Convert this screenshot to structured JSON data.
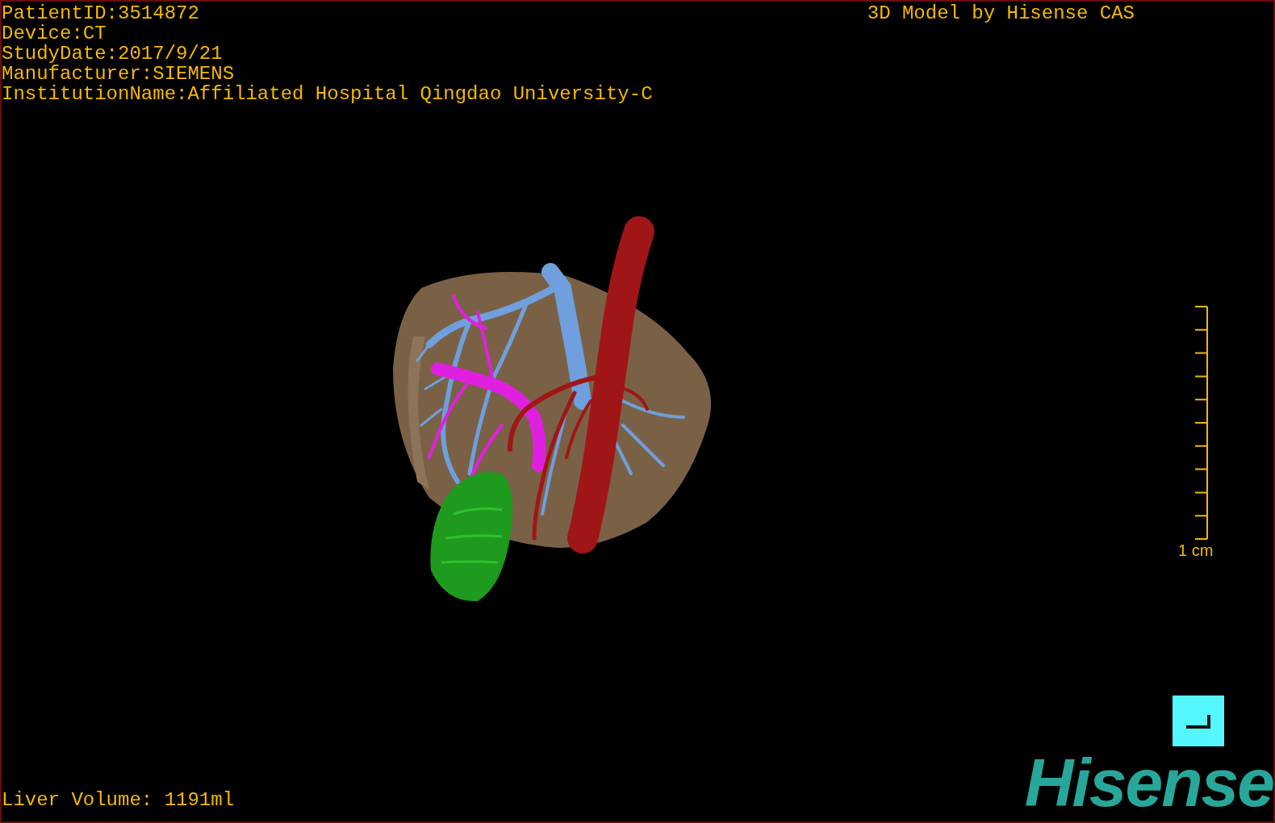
{
  "patient_info": [
    "PatientID:3514872",
    "Device:CT",
    "StudyDate:2017/9/21",
    "Manufacturer:SIEMENS",
    "InstitutionName:Affiliated Hospital Qingdao University-C"
  ],
  "model_credit": "3D Model by Hisense CAS",
  "scale_bar": {
    "label": "1 cm"
  },
  "liver_volume": "Liver Volume: 1191ml",
  "logo": "Hisense"
}
